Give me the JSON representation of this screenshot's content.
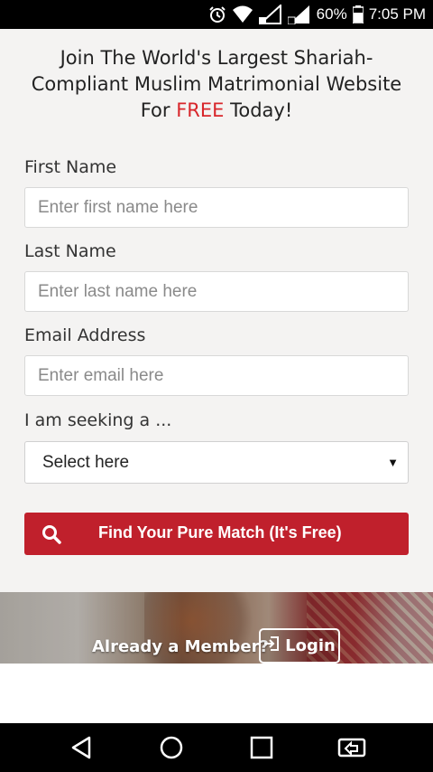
{
  "status_bar": {
    "battery": "60%",
    "time": "7:05 PM",
    "icons": [
      "alarm-icon",
      "wifi-icon",
      "signal-icon",
      "signal-icon",
      "battery-icon"
    ]
  },
  "headline": {
    "line_before_free": "Join The World's Largest Shariah-Compliant Muslim Matrimonial Website For ",
    "free": "FREE",
    "line_after_free": " Today!",
    "free_color": "#d8262b"
  },
  "form": {
    "first_name": {
      "label": "First Name",
      "placeholder": "Enter first name here",
      "value": ""
    },
    "last_name": {
      "label": "Last Name",
      "placeholder": "Enter last name here",
      "value": ""
    },
    "email": {
      "label": "Email Address",
      "placeholder": "Enter email here",
      "value": ""
    },
    "seeking": {
      "label": "I am seeking a ...",
      "selected": "Select here"
    },
    "submit_label": "Find Your Pure Match (It's Free)",
    "submit_color": "#c0202c"
  },
  "banner": {
    "member_text": "Already a Member?",
    "login_label": "Login",
    "login_icon": "login-icon"
  },
  "nav_bar": {
    "icons": [
      "back-icon",
      "home-icon",
      "recents-icon",
      "screen-mirror-icon"
    ]
  }
}
